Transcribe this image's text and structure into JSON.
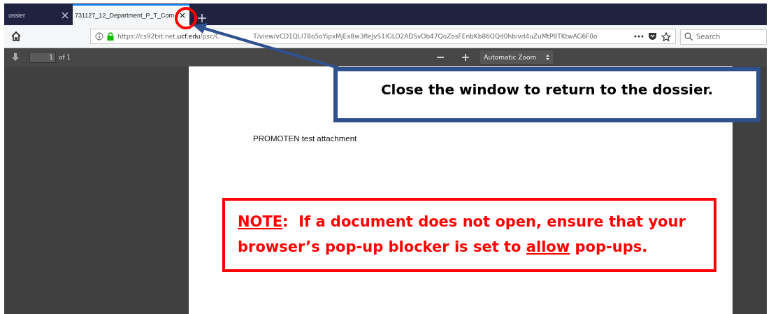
{
  "tabs": [
    {
      "label": "ossier",
      "selected": false
    },
    {
      "label": "731127_12_Department_P_T_Com",
      "selected": true
    }
  ],
  "address_bar": {
    "scheme_host": "https://cs92tst.net.",
    "domain": "ucf.edu",
    "path_before_arrow": "/psc/C",
    "path_after_arrow": "T/view/vCD1QLl78o5oYipxMjEx8w3fleJvS1IGLO2ADSvOb47QoZosFEnbKb86QQd0hbivd4uZuMtP8TKtwAG6F0o"
  },
  "search": {
    "placeholder": "Search"
  },
  "pdf_toolbar": {
    "page": "1",
    "page_count": "of 1",
    "zoom": "Automatic Zoom"
  },
  "document": {
    "text": "PROMOTEN test attachment"
  },
  "callout": {
    "text": "Close the window to return to the dossier."
  },
  "note": {
    "segments": [
      {
        "text": "NOTE",
        "underline": true
      },
      {
        "text": ":  If a document does not open, ensure that your browser’s pop-up blocker is set to ",
        "underline": false
      },
      {
        "text": "allow",
        "underline": true
      },
      {
        "text": " pop-ups.",
        "underline": false
      }
    ]
  }
}
